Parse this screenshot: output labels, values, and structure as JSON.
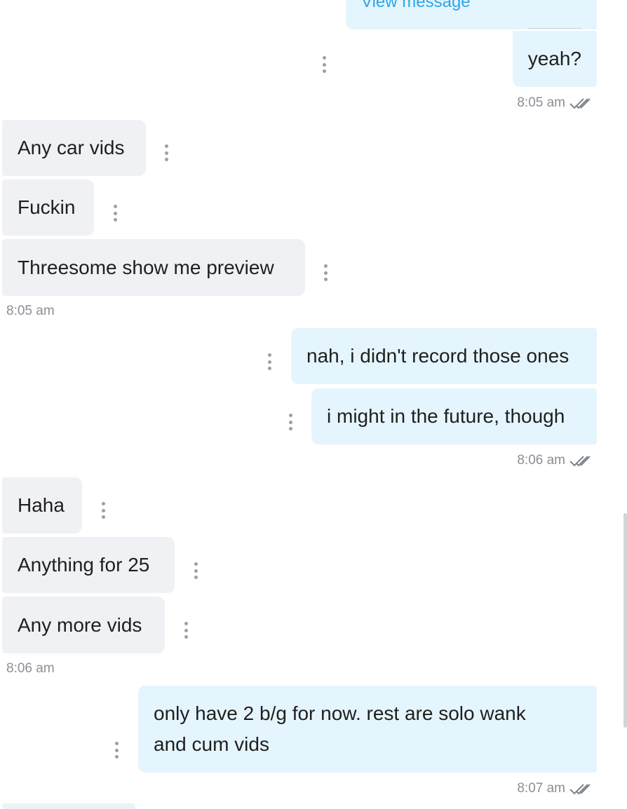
{
  "chat": {
    "view_message": "View message",
    "messages": {
      "m1": "yeah?",
      "m2": "Any car vids",
      "m3": "Fuckin",
      "m4": "Threesome show me preview",
      "m5": "nah, i didn't record those ones",
      "m6": "i might in the future, though",
      "m7": "Haha",
      "m8": "Anything for 25",
      "m9": "Any more vids",
      "m10_line1": "only have 2 b/g for now. rest are solo wank",
      "m10_line2": "and cum vids"
    },
    "timestamps": {
      "t1": "8:05 am",
      "t2": "8:05 am",
      "t3": "8:06 am",
      "t4": "8:06 am",
      "t5": "8:07 am"
    }
  },
  "colors": {
    "incoming_bubble": "#f0f1f4",
    "outgoing_bubble": "#e5f5fd",
    "link": "#2ca6e8",
    "timestamp": "#8a8f96"
  },
  "icons": {
    "more_options": "kebab-vertical-icon",
    "read_receipt": "double-check-icon"
  }
}
